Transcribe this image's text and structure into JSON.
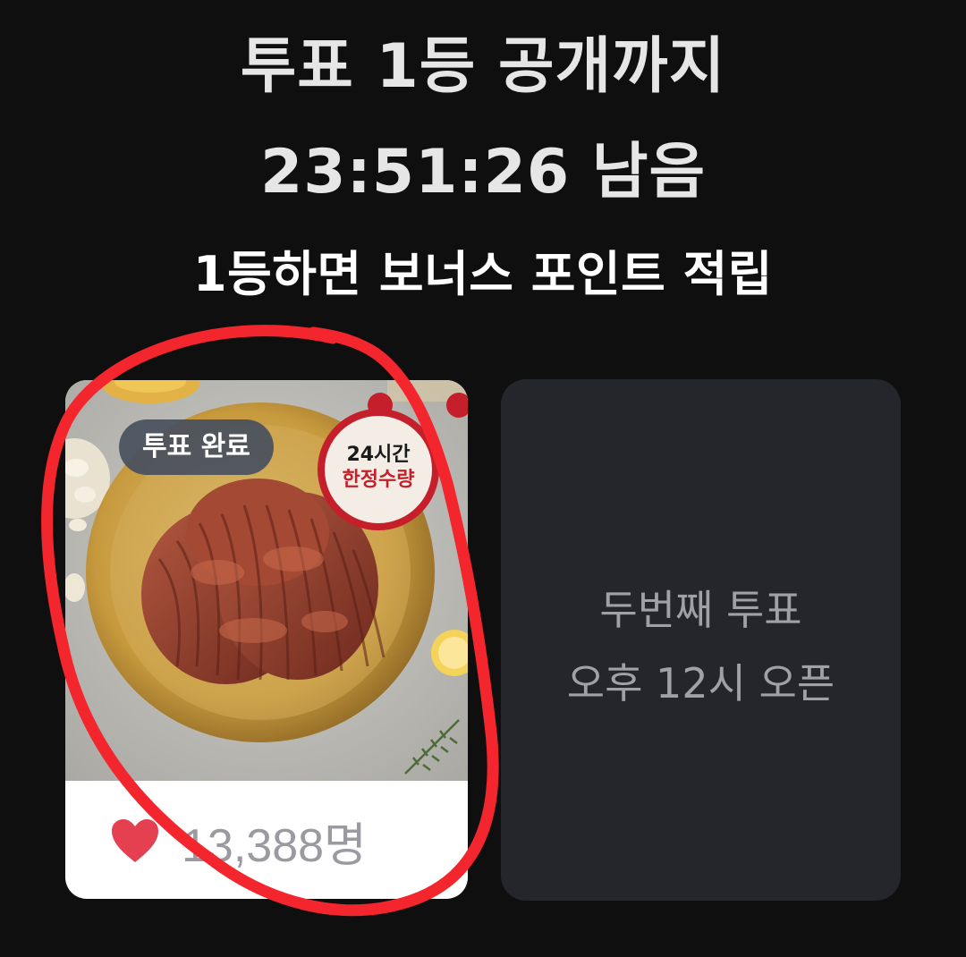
{
  "header": {
    "title_line1": "투표 1등 공개까지",
    "countdown_line": "23:51:26 남음",
    "subtitle": "1등하면 보너스 포인트 적립"
  },
  "vote_card": {
    "status_badge": "투표 완료",
    "image_badge_line1": "24시간",
    "image_badge_line2": "한정수량",
    "likes_count": "13,388명",
    "icon": "heart-icon"
  },
  "locked_card": {
    "line1": "두번째 투표",
    "line2": "오후 12시 오픈"
  },
  "colors": {
    "background": "#0f0f10",
    "locked_card_bg": "#25262b",
    "heart": "#e4404f",
    "annotation": "#f2262c",
    "badge_red": "#c41f2a"
  }
}
